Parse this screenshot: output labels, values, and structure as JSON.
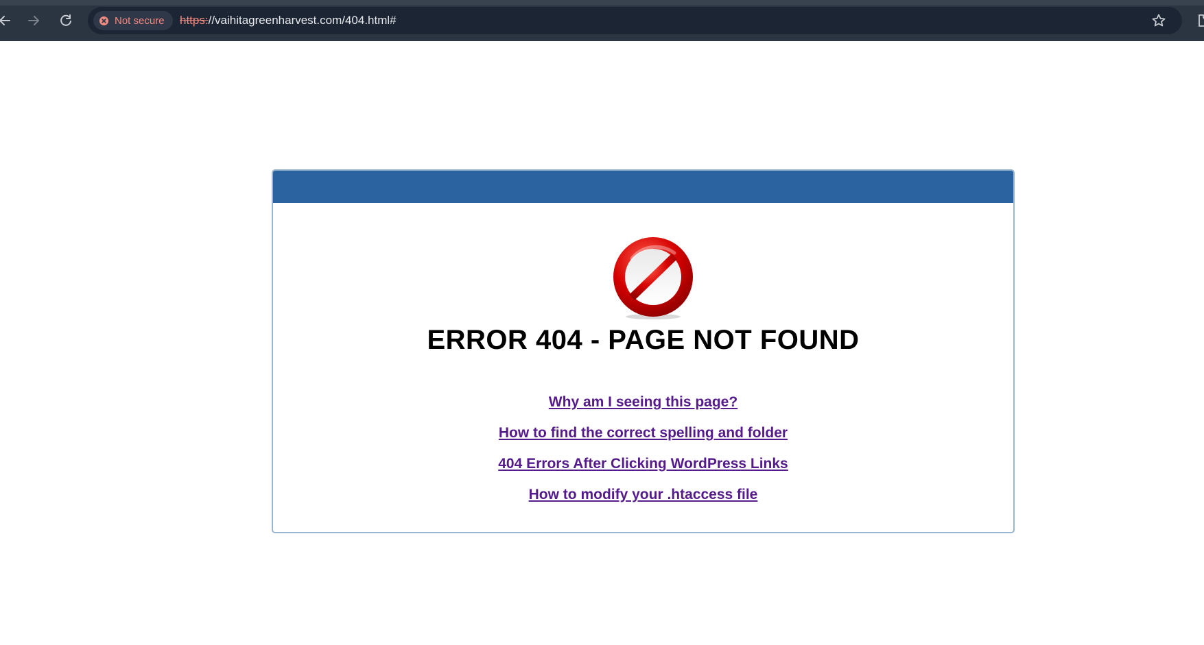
{
  "browser": {
    "security_label": "Not secure",
    "url_scheme": "https:",
    "url_rest": "//vaihitagreenharvest.com/404.html#",
    "icons": [
      "back-arrow-icon",
      "forward-arrow-icon",
      "reload-icon",
      "not-secure-icon",
      "bookmark-star-icon",
      "extensions-icon"
    ]
  },
  "error_page": {
    "title": "ERROR 404 - PAGE NOT FOUND",
    "icon": "prohibited-icon",
    "links": [
      {
        "label": "Why am I seeing this page?"
      },
      {
        "label": "How to find the correct spelling and folder"
      },
      {
        "label": "404 Errors After Clicking WordPress Links"
      },
      {
        "label": "How to modify your .htaccess file"
      }
    ],
    "colors": {
      "header": "#2a63a0",
      "link": "#551a8b",
      "icon_red": "#d40000"
    }
  }
}
